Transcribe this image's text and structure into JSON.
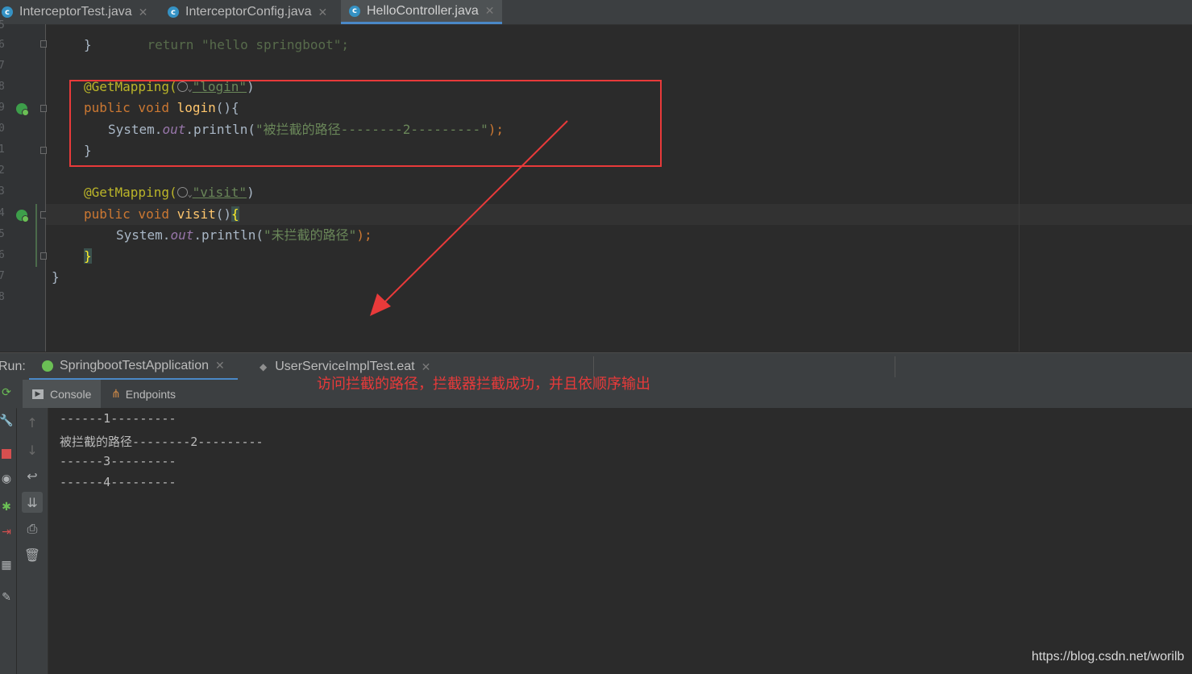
{
  "tabs": [
    {
      "label": "InterceptorTest.java",
      "icon": "class-icon",
      "active": false
    },
    {
      "label": "InterceptorConfig.java",
      "icon": "class-icon",
      "active": false
    },
    {
      "label": "HelloController.java",
      "icon": "class-icon",
      "active": true
    }
  ],
  "editor": {
    "line_numbers": [
      "5",
      "6",
      "7",
      "8",
      "9",
      "0",
      "1",
      "2",
      "3",
      "4",
      "5",
      "6",
      "7",
      "8"
    ],
    "code": {
      "partial": "return \"hello springboot\";",
      "close1": "}",
      "ann_login": "@GetMapping(",
      "path_login": "\"login\"",
      "paren_close": ")",
      "public_void": "public void ",
      "login_fn": "login",
      "login_tail": "(){",
      "sys": "System.",
      "out": "out",
      "println": ".println(",
      "str_login": "\"被拦截的路径--------2---------\"",
      "semi": ");",
      "close_login": "}",
      "ann_visit": "@GetMapping(",
      "path_visit": "\"visit\"",
      "visit_fn": "visit",
      "visit_tail_paren": "()",
      "open_brace": "{",
      "str_visit": "\"未拦截的路径\"",
      "close_visit": "}",
      "close_class": "}"
    }
  },
  "run": {
    "label": "Run:",
    "tabs": [
      {
        "label": "SpringbootTestApplication",
        "active": true
      },
      {
        "label": "UserServiceImplTest.eat",
        "active": false
      }
    ],
    "subtabs": [
      {
        "label": "Console",
        "active": true
      },
      {
        "label": "Endpoints",
        "active": false
      }
    ],
    "console_lines": [
      "------1---------",
      "被拦截的路径--------2---------",
      "------3---------",
      "------4---------"
    ]
  },
  "annotation_note": "访问拦截的路径，拦截器拦截成功，并且依顺序输出",
  "watermark": "https://blog.csdn.net/worilb",
  "colors": {
    "highlight_box": "#e83a3a",
    "arrow": "#e83a3a",
    "active_tab_underline": "#4a88c7"
  }
}
